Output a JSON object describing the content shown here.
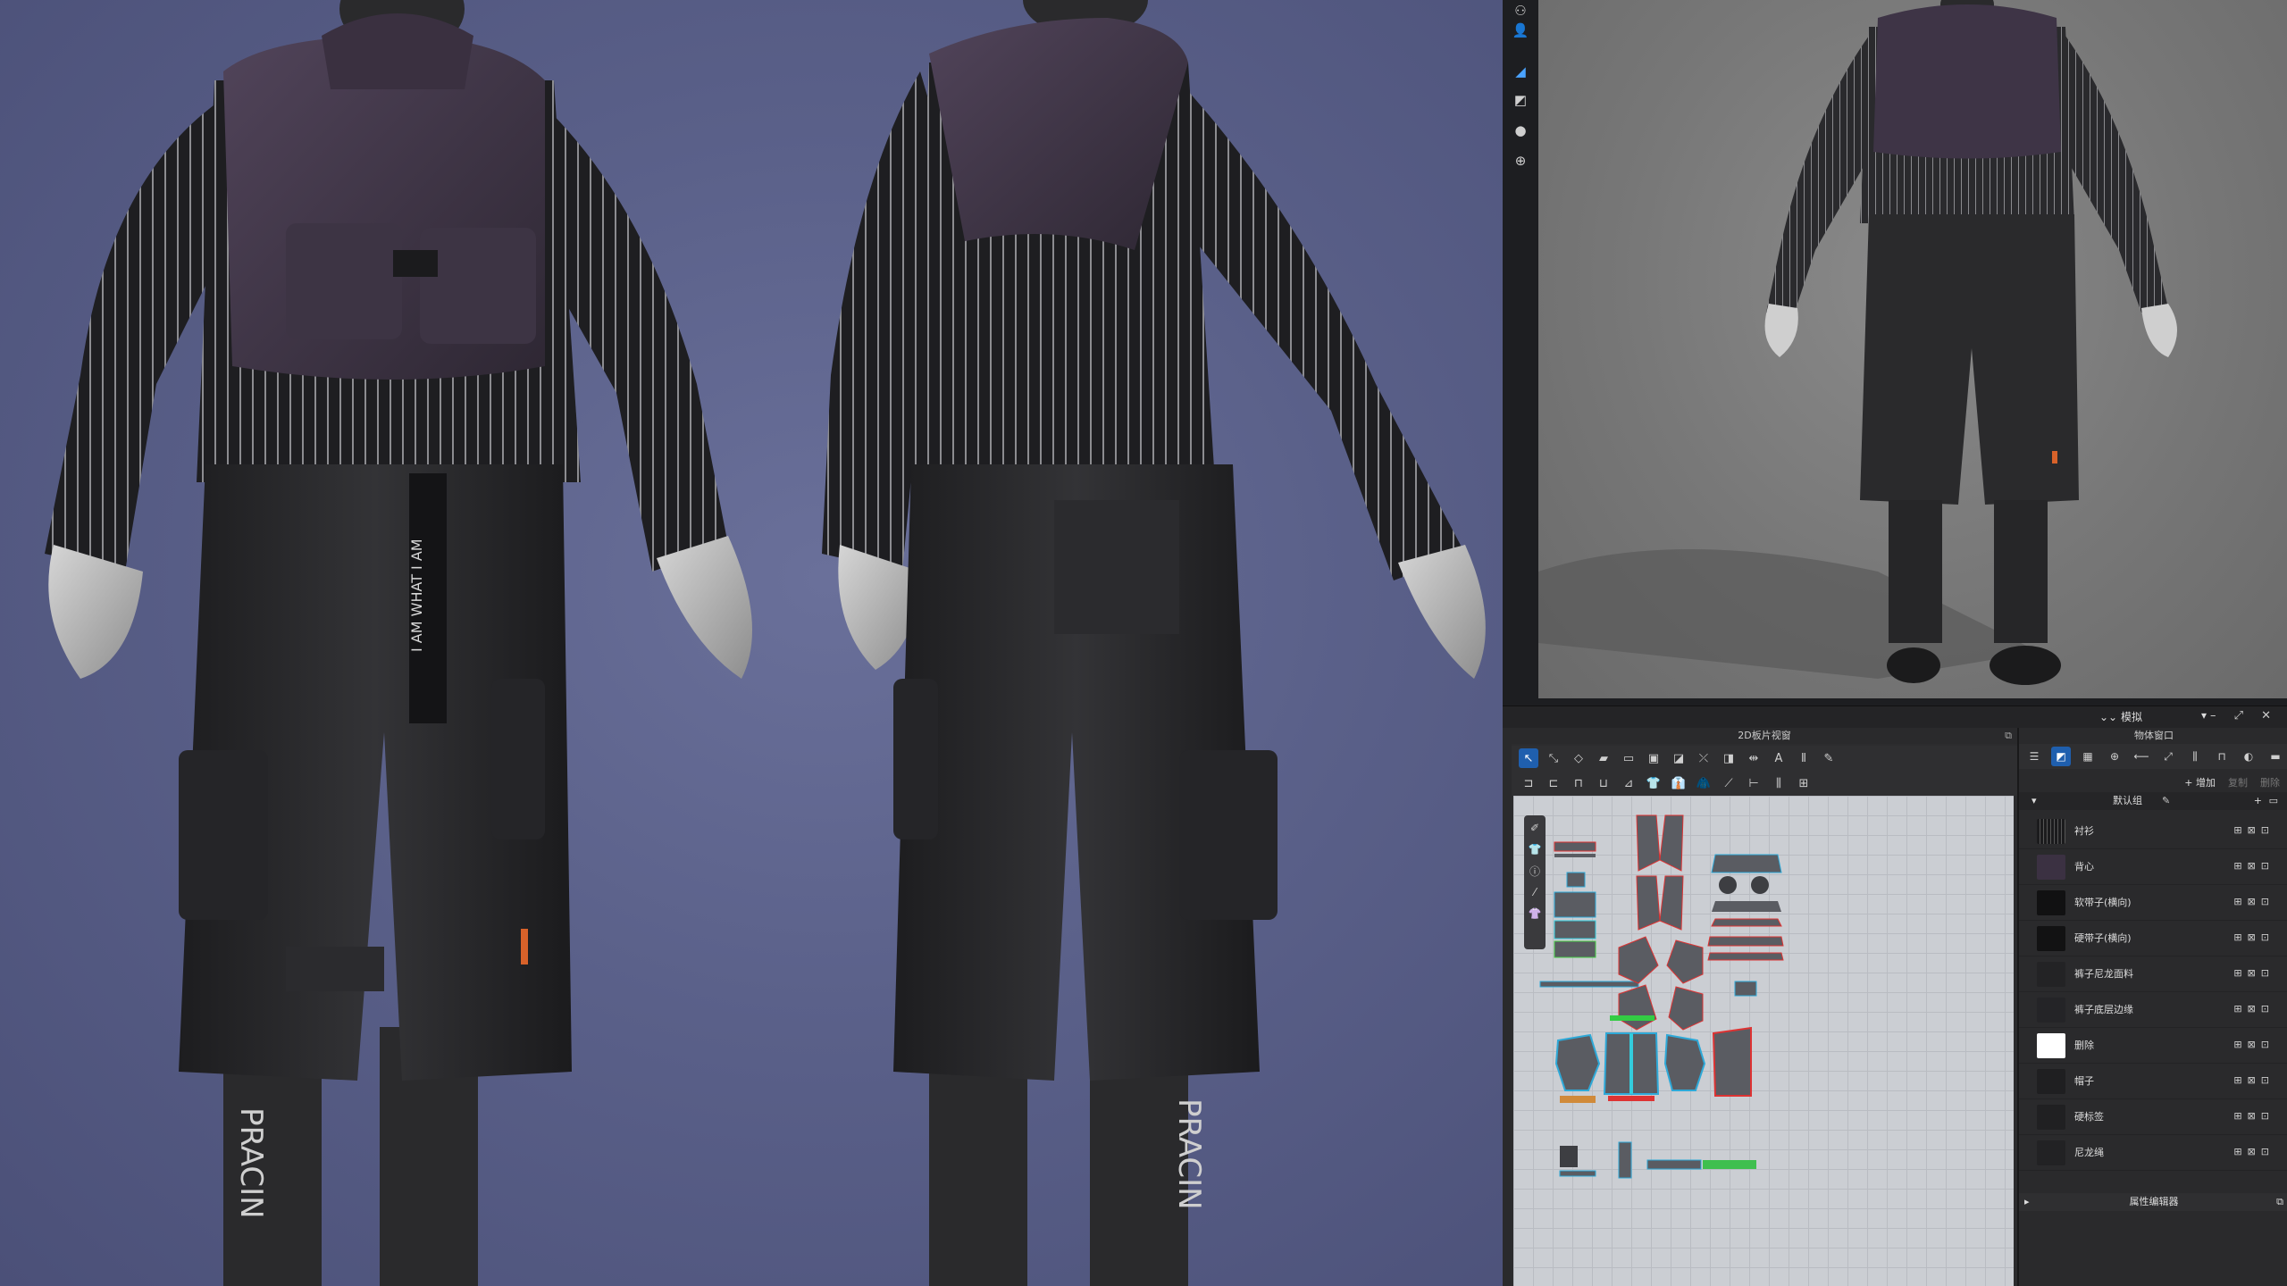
{
  "viewport_toolbar": {
    "icons": [
      "avatar-group-icon",
      "avatar-icon",
      "garment-icon",
      "fabric-icon",
      "skin-icon",
      "globe-icon"
    ]
  },
  "render": {
    "front_belt_text": "I AM WHAT I AM",
    "sock_text_left": "PRACIN",
    "sock_text_right": "PRACIN"
  },
  "simulate": {
    "mode_label": "模拟",
    "window_controls": "– ⤢ ✕"
  },
  "pattern_window": {
    "title": "2D板片视窗"
  },
  "object_window": {
    "title": "物体窗口",
    "actions": {
      "add": "+ 增加",
      "copy": "复制",
      "delete": "删除"
    },
    "group": {
      "label": "默认组"
    },
    "materials": [
      {
        "name": "衬衫",
        "swatch": "#1b1b1d"
      },
      {
        "name": "背心",
        "swatch": "#3b3142"
      },
      {
        "name": "软带子(横向)",
        "swatch": "#111112"
      },
      {
        "name": "硬带子(横向)",
        "swatch": "#121213"
      },
      {
        "name": "裤子尼龙面料",
        "swatch": "#232325"
      },
      {
        "name": "裤子底层边缘",
        "swatch": "#242427"
      },
      {
        "name": "删除",
        "swatch": "#ffffff"
      },
      {
        "name": "帽子",
        "swatch": "#1f1f21"
      },
      {
        "name": "硬标签",
        "swatch": "#202022"
      },
      {
        "name": "尼龙绳",
        "swatch": "#222224"
      }
    ]
  },
  "property_editor": {
    "title": "属性编辑器"
  },
  "colors": {
    "accent": "#1f5fae",
    "background": "#585e82"
  }
}
